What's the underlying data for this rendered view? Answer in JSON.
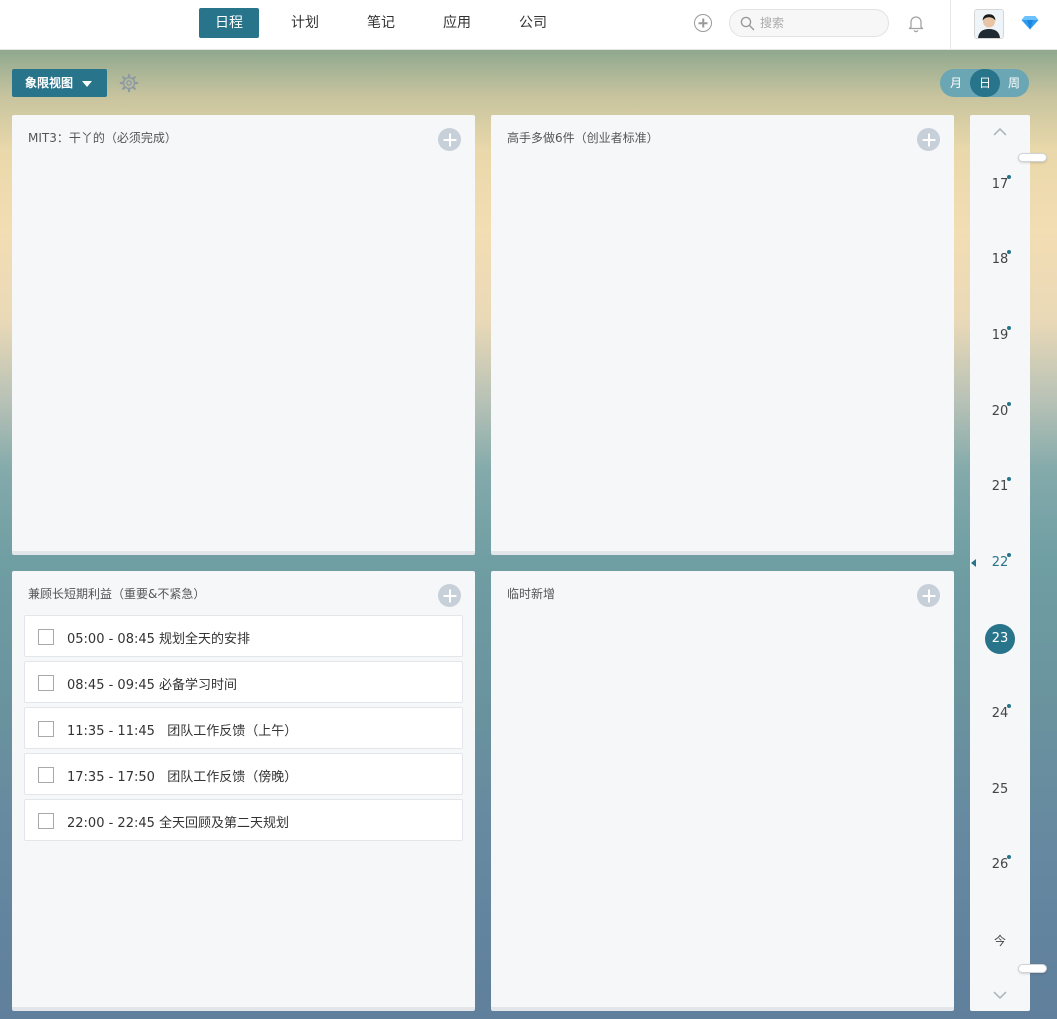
{
  "nav": {
    "tabs": [
      {
        "label": "日程",
        "active": true
      },
      {
        "label": "计划",
        "active": false
      },
      {
        "label": "笔记",
        "active": false
      },
      {
        "label": "应用",
        "active": false
      },
      {
        "label": "公司",
        "active": false
      }
    ],
    "search_placeholder": "搜索",
    "icons": [
      "add-circle-icon",
      "search-icon",
      "bell-icon",
      "avatar",
      "gem-icon"
    ],
    "accent_color": "#27748b"
  },
  "toolbar": {
    "view_label": "象限视图",
    "view_mode": {
      "options": [
        "月",
        "日",
        "周"
      ],
      "selected": "日"
    }
  },
  "quadrants": [
    {
      "title": "MIT3：干丫的（必须完成）",
      "tasks": []
    },
    {
      "title": "高手多做6件（创业者标准）",
      "tasks": []
    },
    {
      "title": "兼顾长短期利益（重要&不紧急）",
      "tasks": [
        {
          "text": "05:00 - 08:45 规划全天的安排",
          "done": false
        },
        {
          "text": "08:45 - 09:45 必备学习时间",
          "done": false
        },
        {
          "text": "11:35 - 11:45   团队工作反馈（上午）",
          "done": false
        },
        {
          "text": "17:35 - 17:50   团队工作反馈（傍晚）",
          "done": false
        },
        {
          "text": "22:00 - 22:45 全天回顾及第二天规划",
          "done": false
        }
      ]
    },
    {
      "title": "临时新增",
      "tasks": []
    }
  ],
  "date_rail": {
    "days": [
      {
        "label": "17",
        "has_events": true,
        "state": ""
      },
      {
        "label": "18",
        "has_events": true,
        "state": ""
      },
      {
        "label": "19",
        "has_events": true,
        "state": ""
      },
      {
        "label": "20",
        "has_events": true,
        "state": ""
      },
      {
        "label": "21",
        "has_events": true,
        "state": ""
      },
      {
        "label": "22",
        "has_events": true,
        "state": "current"
      },
      {
        "label": "23",
        "has_events": false,
        "state": "selected"
      },
      {
        "label": "24",
        "has_events": true,
        "state": ""
      },
      {
        "label": "25",
        "has_events": false,
        "state": ""
      },
      {
        "label": "26",
        "has_events": true,
        "state": ""
      }
    ],
    "today_label": "今"
  }
}
